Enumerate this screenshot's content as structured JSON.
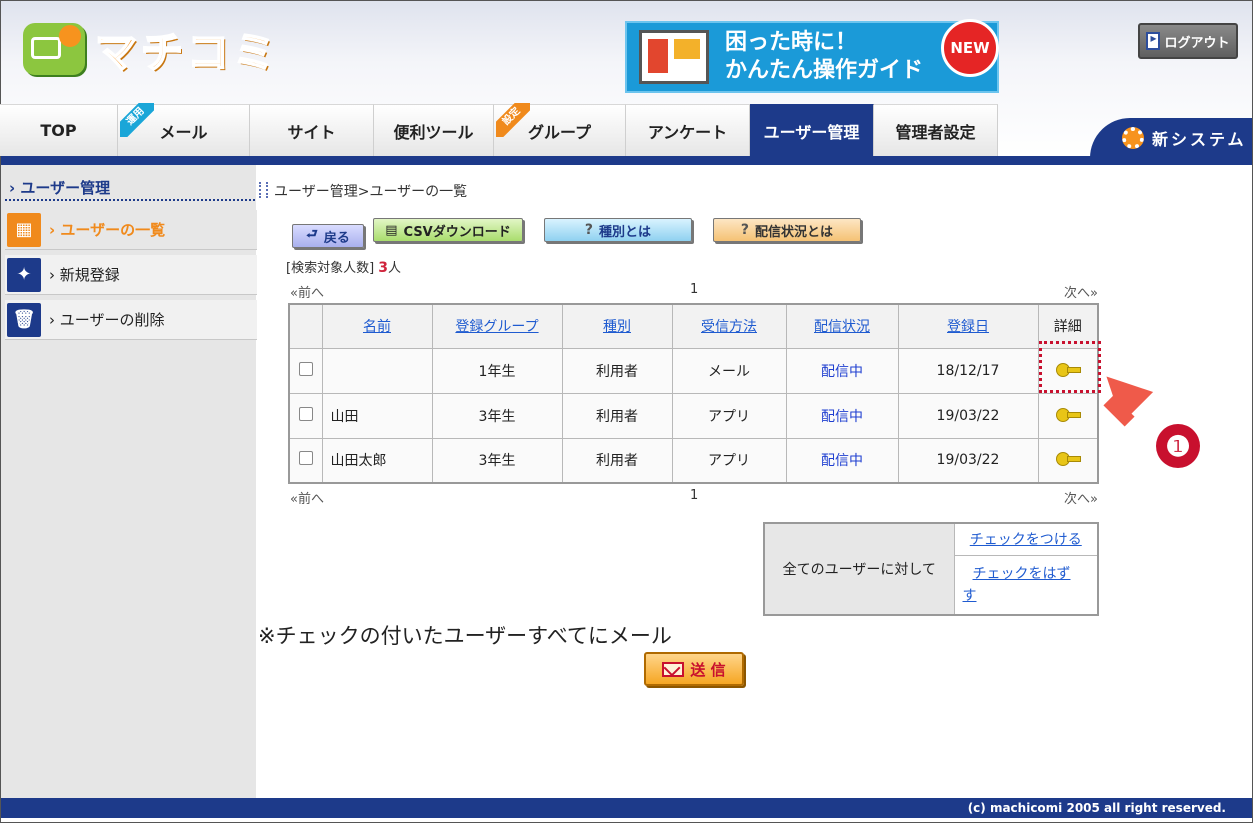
{
  "header": {
    "logo_text": "マチコミ",
    "banner_line1": "困った時に！",
    "banner_line2": "かんたん操作ガイド",
    "banner_badge": "NEW",
    "logout_label": "ログアウト",
    "new_system_label": "新システム"
  },
  "tabs": [
    {
      "label": "TOP"
    },
    {
      "label": "メール",
      "ribbon": "運用"
    },
    {
      "label": "サイト"
    },
    {
      "label": "便利ツール"
    },
    {
      "label": "グループ",
      "ribbon": "設定"
    },
    {
      "label": "アンケート"
    },
    {
      "label": "ユーザー管理",
      "active": true
    },
    {
      "label": "管理者設定"
    }
  ],
  "sidebar": {
    "heading": "ユーザー管理",
    "items": [
      {
        "label": "ユーザーの一覧",
        "active": true
      },
      {
        "label": "新規登録"
      },
      {
        "label": "ユーザーの削除"
      }
    ]
  },
  "main": {
    "breadcrumb": "ユーザー管理>ユーザーの一覧",
    "buttons": {
      "back": "戻る",
      "csv": "CSVダウンロード",
      "type": "種別とは",
      "status": "配信状況とは"
    },
    "count_label": "[検索対象人数]",
    "count_value": "3",
    "count_unit": "人",
    "pager": {
      "prev": "前へ",
      "page": "1",
      "next": "次へ"
    },
    "table": {
      "headers": [
        "名前",
        "登録グループ",
        "種別",
        "受信方法",
        "配信状況",
        "登録日",
        "詳細"
      ],
      "rows": [
        {
          "name": "",
          "group": "1年生",
          "type": "利用者",
          "method": "メール",
          "status": "配信中",
          "date": "18/12/17"
        },
        {
          "name": "山田",
          "group": "3年生",
          "type": "利用者",
          "method": "アプリ",
          "status": "配信中",
          "date": "19/03/22"
        },
        {
          "name": "山田太郎",
          "group": "3年生",
          "type": "利用者",
          "method": "アプリ",
          "status": "配信中",
          "date": "19/03/22"
        }
      ]
    },
    "bulk": {
      "label": "全てのユーザーに対して",
      "check_all": "チェックをつける",
      "uncheck_all": "チェックをはずす"
    },
    "note": "※チェックの付いたユーザーすべてにメール",
    "send_label": "送 信"
  },
  "annotation": {
    "step": "❶"
  },
  "footer": {
    "copyright": "(c) machicomi 2005 all right reserved."
  }
}
